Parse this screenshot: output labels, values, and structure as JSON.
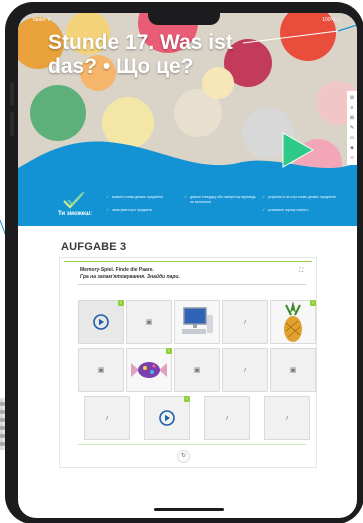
{
  "status": {
    "carrier": "Tablet ᯤ",
    "battery": "100% ▭"
  },
  "hero": {
    "title": "Stunde 17. Was ist das? • Що це?"
  },
  "toolbar": {
    "icons": [
      "gear-icon",
      "list-icon",
      "grid-icon",
      "pencil-icon",
      "monitor-icon",
      "tag-icon",
      "share-icon"
    ]
  },
  "skills": {
    "label": "Ти зможеш:",
    "items": [
      "вивчити назви деяких предметів",
      "запитувати про предмети",
      "давати стверджу або заперечну відповідь на запитання",
      "розрізняти на слух назви деяких предметів",
      "розвивати зорову пам'ять"
    ]
  },
  "task": {
    "title": "AUFGABE 3",
    "instruction_de": "Memory-Spiel. Finde die Paare.",
    "instruction_uk": "Гра на запам'ятовування. Знайди пари.",
    "reset_label": "↻",
    "expand_label": "⛶"
  },
  "grid": {
    "rows": [
      [
        {
          "type": "play"
        },
        {
          "type": "image"
        },
        {
          "type": "computer"
        },
        {
          "type": "audio"
        },
        {
          "type": "pineapple"
        }
      ],
      [
        {
          "type": "image"
        },
        {
          "type": "candy"
        },
        {
          "type": "image"
        },
        {
          "type": "audio"
        },
        {
          "type": "image"
        }
      ],
      [
        {
          "type": "audio"
        },
        {
          "type": "play"
        },
        {
          "type": "audio"
        },
        {
          "type": "audio"
        }
      ]
    ]
  },
  "colors": {
    "hero_blue": "#1493d4",
    "accent_green": "#8fcf3e",
    "play_teal": "#2fc98a"
  }
}
